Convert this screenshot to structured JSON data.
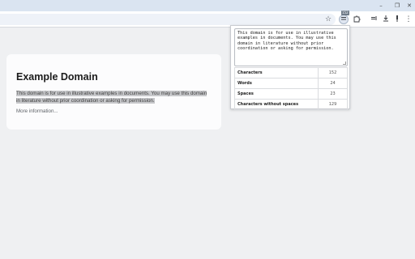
{
  "window": {
    "controls": {
      "minimize": "–",
      "restore": "❐",
      "close": "✕"
    }
  },
  "toolbar": {
    "icons": [
      "star-icon",
      "word-counter-extension-icon",
      "puzzle-extensions-icon",
      "media-control-icon",
      "download-icon",
      "pin-icon",
      "more-menu-icon"
    ],
    "extension_badge": "152"
  },
  "page": {
    "heading": "Example Domain",
    "paragraph": "This domain is for use in illustrative examples in documents. You may use this domain in literature without prior coordination or asking for permission.",
    "link": "More information..."
  },
  "popup": {
    "textarea_value": "This domain is for use in illustrative examples in documents. You may use this domain in literature without prior coordination or asking for permission.",
    "stats": [
      {
        "label": "Characters",
        "value": "152"
      },
      {
        "label": "Words",
        "value": "24"
      },
      {
        "label": "Spaces",
        "value": "23"
      },
      {
        "label": "Characters without spaces",
        "value": "129"
      }
    ]
  },
  "colors": {
    "titlebar": "#dae4f1",
    "page_background": "#eff0f2",
    "selection_highlight": "#c7c8cb"
  }
}
